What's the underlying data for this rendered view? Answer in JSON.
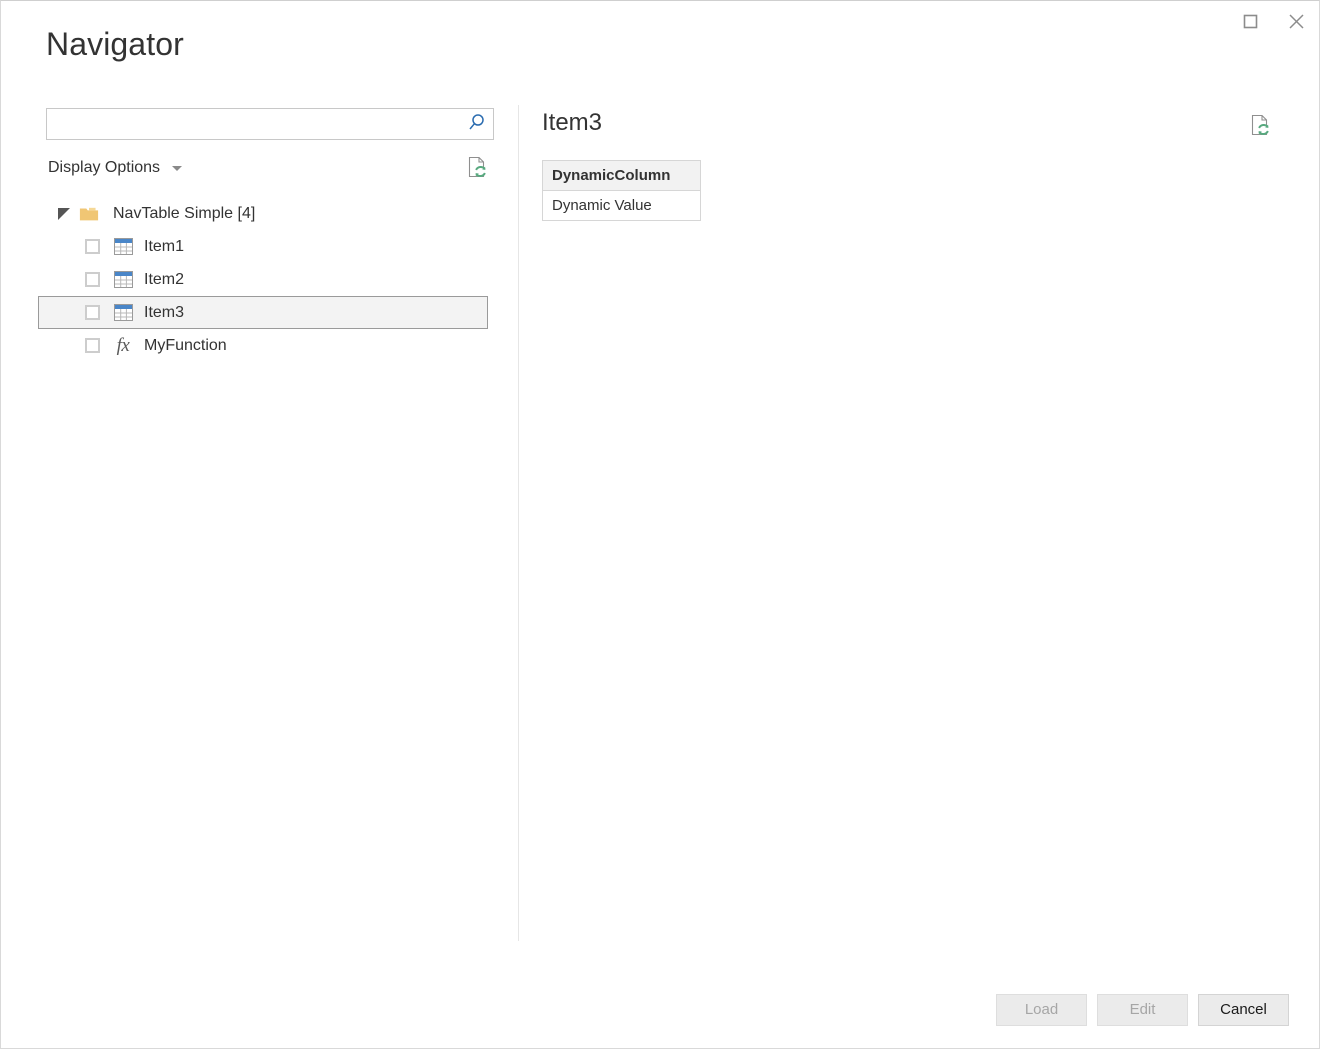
{
  "window": {
    "title": "Navigator",
    "controls": [
      {
        "name": "maximize",
        "icon": "maximize-icon",
        "tooltip": "Maximize"
      },
      {
        "name": "close",
        "icon": "close-icon",
        "tooltip": "Close"
      }
    ]
  },
  "search": {
    "value": "",
    "placeholder": "",
    "icon": "search-icon",
    "accent_color": "#2b6cb0"
  },
  "display_options": {
    "label": "Display Options",
    "caret_icon": "chevron-down-icon",
    "refresh_icon": "refresh-document-icon"
  },
  "tree": {
    "root": {
      "label": "NavTable Simple [4]",
      "icon": "folder-icon",
      "expander_icon": "triangle-expanded-icon",
      "expanded": true,
      "folder_color": "#f0c674"
    },
    "items": [
      {
        "label": "Item1",
        "icon": "table-icon",
        "checked": false,
        "selected": false
      },
      {
        "label": "Item2",
        "icon": "table-icon",
        "checked": false,
        "selected": false
      },
      {
        "label": "Item3",
        "icon": "table-icon",
        "checked": false,
        "selected": true
      },
      {
        "label": "MyFunction",
        "icon": "function-fx-icon",
        "checked": false,
        "selected": false
      }
    ]
  },
  "preview": {
    "title": "Item3",
    "refresh_icon": "refresh-document-icon",
    "table": {
      "columns": [
        "DynamicColumn"
      ],
      "rows": [
        [
          "Dynamic Value"
        ]
      ]
    }
  },
  "footer": {
    "buttons": [
      {
        "label": "Load",
        "enabled": false
      },
      {
        "label": "Edit",
        "enabled": false
      },
      {
        "label": "Cancel",
        "enabled": true
      }
    ]
  }
}
